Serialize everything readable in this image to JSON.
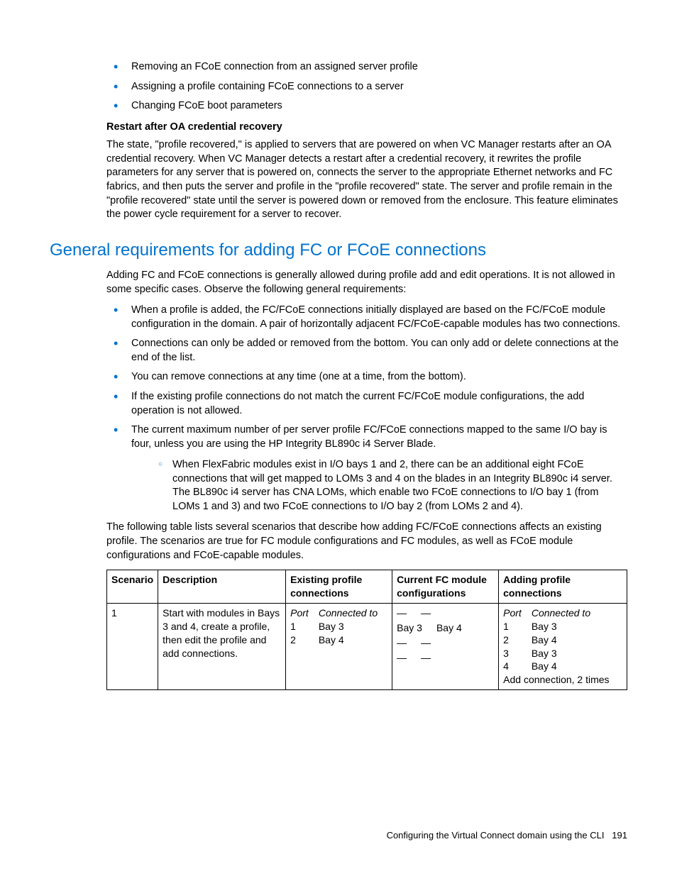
{
  "intro_bullets": [
    "Removing an FCoE connection from an assigned server profile",
    "Assigning a profile containing FCoE connections to a server",
    "Changing FCoE boot parameters"
  ],
  "restart": {
    "heading": "Restart after OA credential recovery",
    "body": "The state, \"profile recovered,\" is applied to servers that are powered on when VC Manager restarts after an OA credential recovery. When VC Manager detects a restart after a credential recovery, it rewrites the profile parameters for any server that is powered on, connects the server to the appropriate Ethernet networks and FC fabrics, and then puts the server and profile in the \"profile recovered\" state. The server and profile remain in the \"profile recovered\" state until the server is powered down or removed from the enclosure. This feature eliminates the power cycle requirement for a server to recover."
  },
  "section_title": "General requirements for adding FC or FCoE connections",
  "section_intro": "Adding FC and FCoE connections is generally allowed during profile add and edit operations. It is not allowed in some specific cases. Observe the following general requirements:",
  "req_bullets": [
    "When a profile is added, the FC/FCoE connections initially displayed are based on the FC/FCoE module configuration in the domain. A pair of horizontally adjacent FC/FCoE-capable modules has two connections.",
    "Connections can only be added or removed from the bottom. You can only add or delete connections at the end of the list.",
    "You can remove connections at any time (one at a time, from the bottom).",
    "If the existing profile connections do not match the current FC/FCoE module configurations, the add operation is not allowed.",
    "The current maximum number of per server profile FC/FCoE connections mapped to the same I/O bay is four, unless you are using the HP Integrity BL890c i4 Server Blade."
  ],
  "sub_bullet": "When FlexFabric modules exist in I/O bays 1 and 2, there can be an additional eight FCoE connections that will get mapped to LOMs 3 and 4 on the blades in an Integrity BL890c i4 server. The BL890c i4 server has CNA LOMs, which enable two FCoE connections to I/O bay 1 (from LOMs 1 and 3) and two FCoE connections to I/O bay 2 (from LOMs 2 and 4).",
  "table_intro": "The following table lists several scenarios that describe how adding FC/FCoE connections affects an existing profile. The scenarios are true for FC module configurations and FC modules, as well as FCoE module configurations and FCoE-capable modules.",
  "table": {
    "headers": [
      "Scenario",
      "Description",
      "Existing profile connections",
      "Current FC module configurations",
      "Adding profile connections"
    ],
    "row": {
      "scenario": "1",
      "description": "Start with modules in Bays 3 and 4, create a profile, then edit the profile and add connections.",
      "existing": {
        "port_label": "Port",
        "conn_label": "Connected to",
        "ports": [
          "1",
          "2"
        ],
        "conns": [
          "Bay 3",
          "Bay 4"
        ]
      },
      "current": {
        "r1c1": "—",
        "r1c2": "—",
        "r2c1": "Bay 3",
        "r2c2": "Bay 4",
        "r3c1": "—",
        "r3c2": "—",
        "r4c1": "—",
        "r4c2": "—"
      },
      "adding": {
        "port_label": "Port",
        "conn_label": "Connected to",
        "ports": [
          "1",
          "2",
          "3",
          "4"
        ],
        "conns": [
          "Bay 3",
          "Bay 4",
          "Bay 3",
          "Bay 4"
        ],
        "note": "Add connection, 2 times"
      }
    }
  },
  "footer": {
    "text": "Configuring the Virtual Connect domain using the CLI",
    "page": "191"
  }
}
